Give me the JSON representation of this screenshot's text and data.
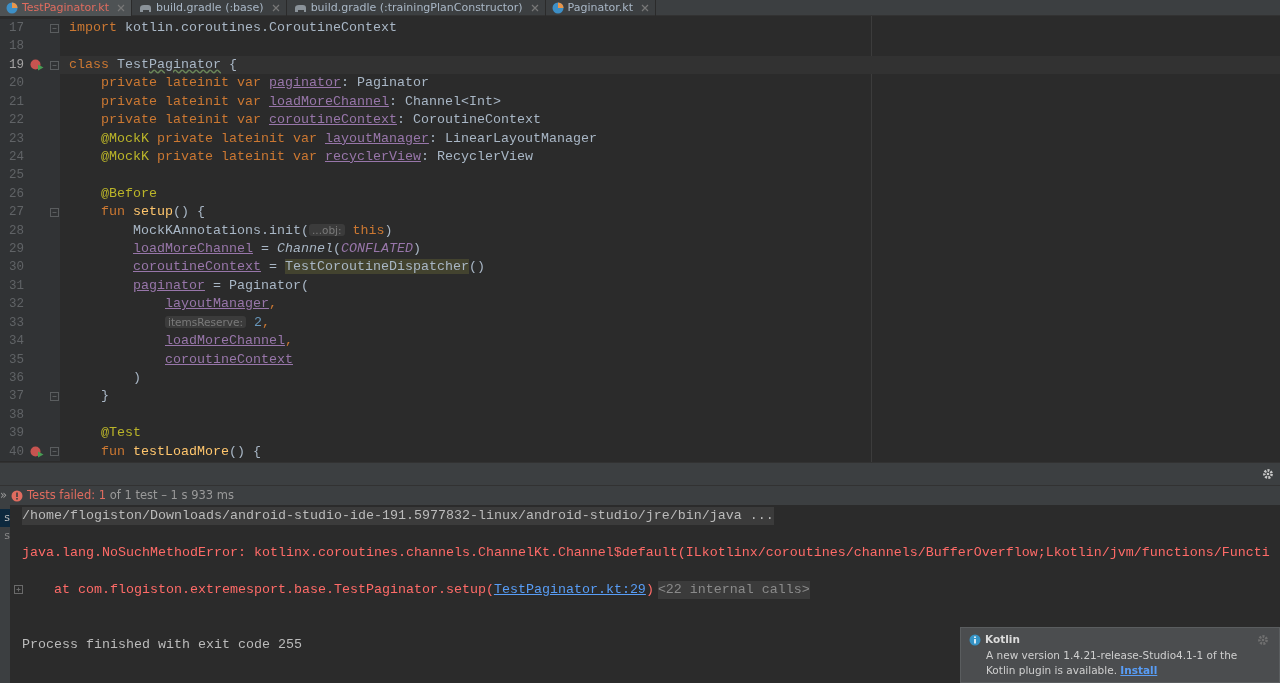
{
  "tabs": [
    {
      "label": "TestPaginator.kt",
      "kind": "kotlin_file",
      "selected": true,
      "error": true
    },
    {
      "label": "build.gradle (:base)",
      "kind": "gradle_file",
      "selected": false,
      "error": false
    },
    {
      "label": "build.gradle (:trainingPlanConstructor)",
      "kind": "gradle_file",
      "selected": false,
      "error": false
    },
    {
      "label": "Paginator.kt",
      "kind": "kotlin_file",
      "selected": false,
      "error": false
    }
  ],
  "editor": {
    "lines": [
      {
        "n": "17",
        "fold": true,
        "run": false,
        "current": false,
        "tokens": [
          {
            "kind": "keyword",
            "t": "import"
          },
          {
            "kind": "plain",
            "t": " kotlin.coroutines.CoroutineContext"
          }
        ]
      },
      {
        "n": "18",
        "fold": false,
        "run": false,
        "current": false
      },
      {
        "n": "19",
        "fold": true,
        "run": true,
        "current": true,
        "tokens": [
          {
            "kind": "keyword",
            "t": "class"
          },
          {
            "kind": "plain",
            "t": " Test"
          },
          {
            "kind": "warning",
            "t": "Paginator"
          },
          {
            "kind": "plain",
            "t": " {"
          }
        ],
        "children": [
          {
            "n": "20",
            "fold": false,
            "run": false,
            "current": false,
            "tokens": [
              {
                "kind": "keyword",
                "t": "private lateinit var "
              },
              {
                "kind": "property",
                "t": "paginator"
              },
              {
                "kind": "plain",
                "t": ": Paginator"
              }
            ]
          },
          {
            "n": "21",
            "fold": false,
            "run": false,
            "current": false,
            "tokens": [
              {
                "kind": "keyword",
                "t": "private lateinit var "
              },
              {
                "kind": "property",
                "t": "loadMoreChannel"
              },
              {
                "kind": "plain",
                "t": ": Channel<Int>"
              }
            ]
          },
          {
            "n": "22",
            "fold": false,
            "run": false,
            "current": false,
            "tokens": [
              {
                "kind": "keyword",
                "t": "private lateinit var "
              },
              {
                "kind": "property",
                "t": "coroutineContext"
              },
              {
                "kind": "plain",
                "t": ": CoroutineContext"
              }
            ]
          },
          {
            "n": "23",
            "fold": false,
            "run": false,
            "current": false,
            "tokens": [
              {
                "kind": "annotation",
                "t": "@MockK"
              },
              {
                "kind": "keyword",
                "t": " private lateinit var "
              },
              {
                "kind": "property",
                "t": "layoutManager"
              },
              {
                "kind": "plain",
                "t": ": LinearLayoutManager"
              }
            ]
          },
          {
            "n": "24",
            "fold": false,
            "run": false,
            "current": false,
            "tokens": [
              {
                "kind": "annotation",
                "t": "@MockK"
              },
              {
                "kind": "keyword",
                "t": " private lateinit var "
              },
              {
                "kind": "property",
                "t": "recyclerView"
              },
              {
                "kind": "plain",
                "t": ": RecyclerView"
              }
            ]
          },
          {
            "n": "25",
            "fold": false,
            "run": false,
            "current": false
          },
          {
            "n": "26",
            "fold": false,
            "run": false,
            "current": false,
            "tokens": [
              {
                "kind": "annotation",
                "t": "@Before"
              }
            ]
          },
          {
            "n": "27",
            "fold": true,
            "run": false,
            "current": false,
            "tokens": [
              {
                "kind": "keyword",
                "t": "fun "
              },
              {
                "kind": "function",
                "t": "setup"
              },
              {
                "kind": "plain",
                "t": "() {"
              }
            ],
            "children": [
              {
                "n": "28",
                "fold": false,
                "run": false,
                "current": false,
                "tokens": [
                  {
                    "kind": "plain",
                    "t": "MockKAnnotations.init("
                  },
                  {
                    "kind": "hint",
                    "t": "...obj:"
                  },
                  {
                    "kind": "keyword",
                    "t": " this"
                  },
                  {
                    "kind": "plain",
                    "t": ")"
                  }
                ]
              },
              {
                "n": "29",
                "fold": false,
                "run": false,
                "current": false,
                "tokens": [
                  {
                    "kind": "property",
                    "t": "loadMoreChannel"
                  },
                  {
                    "kind": "plain",
                    "t": " = "
                  },
                  {
                    "kind": "italic",
                    "t": "Channel"
                  },
                  {
                    "kind": "plain",
                    "t": "("
                  },
                  {
                    "kind": "constant",
                    "t": "CONFLATED"
                  },
                  {
                    "kind": "plain",
                    "t": ")"
                  }
                ]
              },
              {
                "n": "30",
                "fold": false,
                "run": false,
                "current": false,
                "tokens": [
                  {
                    "kind": "property",
                    "t": "coroutineContext"
                  },
                  {
                    "kind": "plain",
                    "t": " = "
                  },
                  {
                    "kind": "highlight",
                    "t": "TestCoroutineDispatcher"
                  },
                  {
                    "kind": "plain",
                    "t": "()"
                  }
                ]
              },
              {
                "n": "31",
                "fold": false,
                "run": false,
                "current": false,
                "tokens": [
                  {
                    "kind": "property",
                    "t": "paginator"
                  },
                  {
                    "kind": "plain",
                    "t": " = Paginator("
                  }
                ],
                "children": [
                  {
                    "n": "32",
                    "fold": false,
                    "run": false,
                    "current": false,
                    "tokens": [
                      {
                        "kind": "property",
                        "t": "layoutManager"
                      },
                      {
                        "kind": "keyword",
                        "t": ","
                      }
                    ]
                  },
                  {
                    "n": "33",
                    "fold": false,
                    "run": false,
                    "current": false,
                    "tokens": [
                      {
                        "kind": "hint",
                        "t": "itemsReserve:"
                      },
                      {
                        "kind": "number",
                        "t": " 2"
                      },
                      {
                        "kind": "keyword",
                        "t": ","
                      }
                    ]
                  },
                  {
                    "n": "34",
                    "fold": false,
                    "run": false,
                    "current": false,
                    "tokens": [
                      {
                        "kind": "property",
                        "t": "loadMoreChannel"
                      },
                      {
                        "kind": "keyword",
                        "t": ","
                      }
                    ]
                  },
                  {
                    "n": "35",
                    "fold": false,
                    "run": false,
                    "current": false,
                    "tokens": [
                      {
                        "kind": "property",
                        "t": "coroutineContext"
                      }
                    ]
                  }
                ]
              },
              {
                "n": "36",
                "fold": false,
                "run": false,
                "current": false,
                "tokens": [
                  {
                    "kind": "plain",
                    "t": ")"
                  }
                ]
              }
            ]
          },
          {
            "n": "37",
            "fold": true,
            "run": false,
            "current": false,
            "tokens": [
              {
                "kind": "plain",
                "t": "}"
              }
            ]
          },
          {
            "n": "38",
            "fold": false,
            "run": false,
            "current": false
          },
          {
            "n": "39",
            "fold": false,
            "run": false,
            "current": false,
            "tokens": [
              {
                "kind": "annotation",
                "t": "@Test"
              }
            ]
          },
          {
            "n": "40",
            "fold": true,
            "run": true,
            "current": false,
            "tokens": [
              {
                "kind": "keyword",
                "t": "fun "
              },
              {
                "kind": "function",
                "t": "testLoadMore"
              },
              {
                "kind": "plain",
                "t": "() {"
              }
            ]
          }
        ]
      }
    ]
  },
  "run_panel": {
    "expand_glyph": "»",
    "status": {
      "label": "Tests failed:",
      "failed": "1",
      "rest": "of 1 test – 1 s 933 ms"
    },
    "test_tree": [
      {
        "text": "s",
        "selected": true
      },
      {
        "text": "s",
        "selected": false
      }
    ],
    "console": [
      {
        "kind": "path",
        "text": "/home/flogiston/Downloads/android-studio-ide-191.5977832-linux/android-studio/jre/bin/java ..."
      },
      {
        "kind": "error",
        "text": "java.lang.NoSuchMethodError: kotlinx.coroutines.channels.ChannelKt.Channel$default(ILkotlinx/coroutines/channels/BufferOverflow;Lkotlin/jvm/functions/Functi"
      },
      {
        "kind": "trace",
        "text": "at com.flogiston.extremesport.base.TestPaginator.setup(",
        "link": "TestPaginator.kt:29",
        "after": ")",
        "folded": "<22 internal calls>"
      },
      {
        "kind": "exit",
        "text": "Process finished with exit code 255"
      }
    ]
  },
  "notification": {
    "title": "Kotlin",
    "body": "A new version 1.4.21-release-Studio4.1-1 of the Kotlin plugin is available.",
    "action": "Install"
  }
}
